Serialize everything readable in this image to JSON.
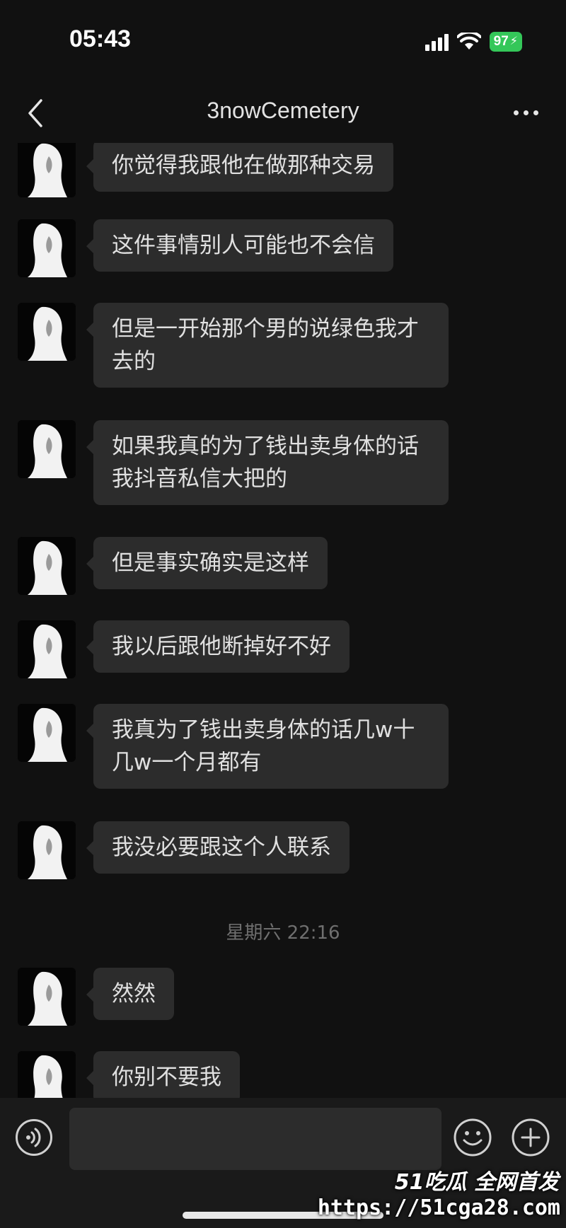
{
  "status_bar": {
    "time": "05:43",
    "battery_level": "97",
    "icons": [
      "signal-icon",
      "wifi-icon",
      "battery-charging-icon"
    ]
  },
  "nav": {
    "title": "3nowCemetery",
    "back_icon": "chevron-left-icon",
    "more_icon": "more-dots-icon"
  },
  "colors": {
    "background": "#111111",
    "bubble": "#2c2c2c",
    "battery": "#34c759"
  },
  "messages": [
    {
      "text": "你觉得我跟他在做那种交易"
    },
    {
      "text": "这件事情别人可能也不会信"
    },
    {
      "text": "但是一开始那个男的说绿色我才去的"
    },
    {
      "text": "如果我真的为了钱出卖身体的话我抖音私信大把的"
    },
    {
      "text": "但是事实确实是这样"
    },
    {
      "text": "我以后跟他断掉好不好"
    },
    {
      "text": "我真为了钱出卖身体的话几w十几w一个月都有"
    },
    {
      "text": "我没必要跟这个人联系"
    },
    {
      "text": "然然"
    },
    {
      "text": "你别不要我"
    }
  ],
  "timestamp": "星期六 22:16",
  "input_bar": {
    "icons": [
      "voice-icon",
      "emoji-icon",
      "plus-icon"
    ],
    "value": ""
  },
  "watermark": {
    "brand": "51吃瓜 全网首发",
    "url": "https://51cga28.com"
  }
}
